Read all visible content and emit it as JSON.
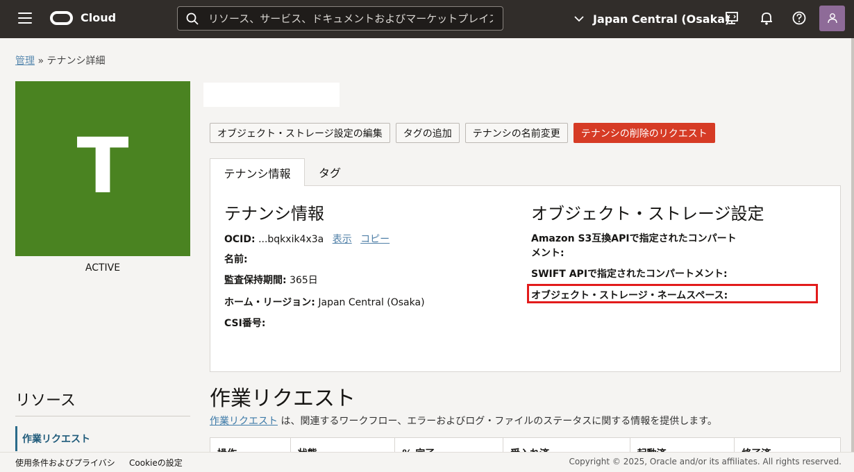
{
  "topbar": {
    "brand": "Cloud",
    "search_placeholder": "リソース、サービス、ドキュメントおよびマーケットプレイス",
    "region": "Japan Central (Osaka)"
  },
  "breadcrumb": {
    "parent": "管理",
    "separator": "»",
    "current": "テナンシ詳細"
  },
  "tenancy": {
    "initial": "T",
    "status": "ACTIVE",
    "tile_color": "#4a8321"
  },
  "actions": {
    "edit_storage": "オブジェクト・ストレージ設定の編集",
    "add_tags": "タグの追加",
    "rename": "テナンシの名前変更",
    "request_delete": "テナンシの削除のリクエスト"
  },
  "tabs": [
    "テナンシ情報",
    "タグ"
  ],
  "info": {
    "heading": "テナンシ情報",
    "ocid_label": "OCID:",
    "ocid_value": "...bqkxik4x3a",
    "show_link": "表示",
    "copy_link": "コピー",
    "name_label": "名前:",
    "audit_label": "監査保持期間:",
    "audit_value": "365日",
    "home_region_label": "ホーム・リージョン:",
    "home_region_value": "Japan Central (Osaka)",
    "csi_label": "CSI番号:"
  },
  "storage": {
    "heading": "オブジェクト・ストレージ設定",
    "s3_label_1": "Amazon S3互換APIで指定されたコンパート",
    "s3_label_2": "メント:",
    "swift_label": "SWIFT APIで指定されたコンパートメント:",
    "namespace_label": "オブジェクト・ストレージ・ネームスペース:"
  },
  "resources": {
    "title": "リソース",
    "items": [
      "作業リクエスト"
    ]
  },
  "work_requests": {
    "title": "作業リクエスト",
    "desc_link": "作業リクエスト",
    "desc_rest": " は、関連するワークフロー、エラーおよびログ・ファイルのステータスに関する情報を提供します。",
    "columns": [
      "操作",
      "状態",
      "% 完了",
      "受入れ済",
      "起動済",
      "終了済"
    ]
  },
  "footer": {
    "terms": "使用条件およびプライバシ",
    "cookies": "Cookieの設定",
    "copyright": "Copyright © 2025, Oracle and/or its affiliates. All rights reserved."
  },
  "colors": {
    "topbar": "#312d2a",
    "danger": "#d63b25",
    "highlight": "#e21b1b",
    "link": "#4f7fa7"
  }
}
